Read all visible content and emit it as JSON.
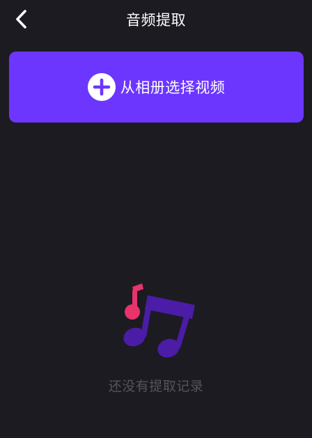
{
  "header": {
    "title": "音频提取",
    "back_icon": "chevron-left-icon"
  },
  "select_button": {
    "label": "从相册选择视频",
    "icon": "plus-circle-icon"
  },
  "empty_state": {
    "icon": "music-notes-icon",
    "message": "还没有提取记录"
  },
  "colors": {
    "background": "#1c1b22",
    "accent": "#6c36ff",
    "note_pink": "#e8336b",
    "note_purple": "#4b1ca6",
    "muted_text": "#55545c"
  }
}
